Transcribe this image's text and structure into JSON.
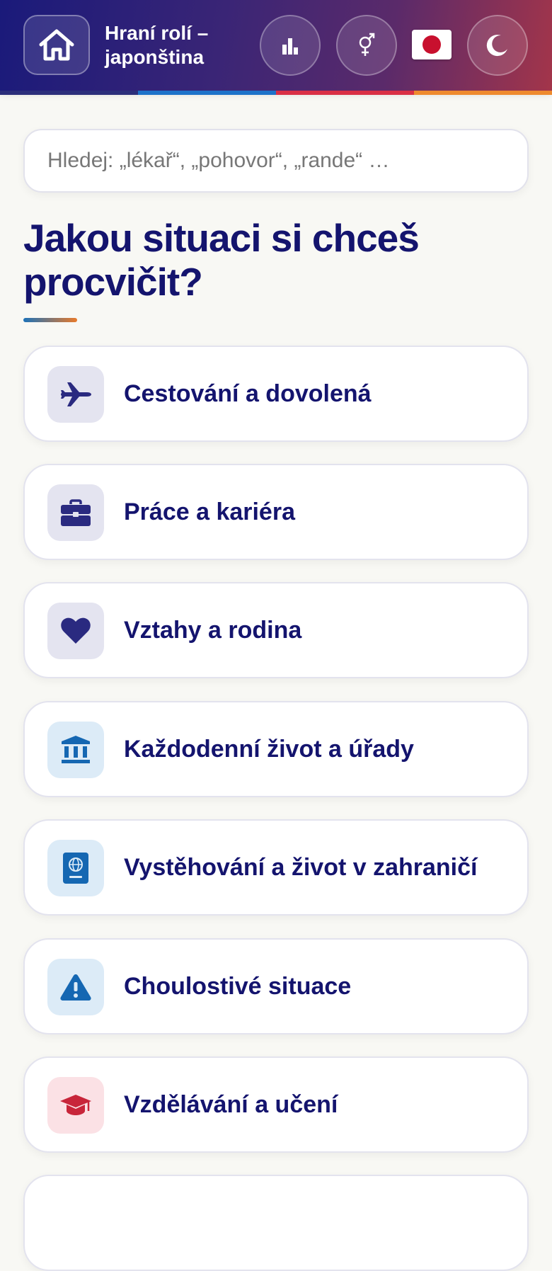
{
  "header": {
    "title": "Hraní rolí – japonština",
    "home_icon": "home-icon",
    "stats_icon": "bar-chart-icon",
    "gender_icon": "gender-icon",
    "language_icon": "japan-flag-icon",
    "theme_icon": "moon-icon"
  },
  "search": {
    "placeholder": "Hledej: „lékař“, „pohovor“, „rande“ …"
  },
  "heading": "Jakou situaci si chceš procvičit?",
  "categories": [
    {
      "label": "Cestování a dovolená",
      "icon": "airplane-icon",
      "color": "#2a2a80",
      "bg": "#e4e4f0"
    },
    {
      "label": "Práce a kariéra",
      "icon": "briefcase-icon",
      "color": "#2a2a80",
      "bg": "#e4e4f0"
    },
    {
      "label": "Vztahy a rodina",
      "icon": "heart-icon",
      "color": "#2a2a80",
      "bg": "#e4e4f0"
    },
    {
      "label": "Každodenní život a úřady",
      "icon": "bank-icon",
      "color": "#1567b2",
      "bg": "#dcebf7"
    },
    {
      "label": "Vystěhování a život v zahraničí",
      "icon": "passport-icon",
      "color": "#1567b2",
      "bg": "#dcebf7"
    },
    {
      "label": "Choulostivé situace",
      "icon": "warning-icon",
      "color": "#1567b2",
      "bg": "#dcebf7"
    },
    {
      "label": "Vzdělávání a učení",
      "icon": "graduation-cap-icon",
      "color": "#c8253a",
      "bg": "#fbe1e5"
    }
  ]
}
